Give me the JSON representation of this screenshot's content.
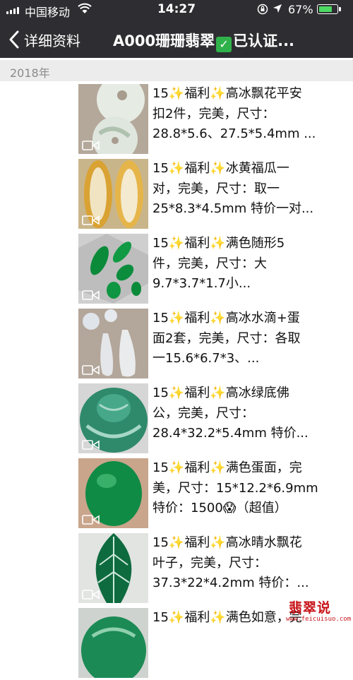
{
  "status_bar": {
    "carrier": "中国移动",
    "time": "14:27",
    "battery": "67%",
    "battery_level": 0.67
  },
  "nav": {
    "back_label": "详细资料",
    "title_prefix": "A000珊珊翡翠",
    "title_suffix": "已认证..."
  },
  "year": "2018年",
  "posts": [
    {
      "lines": [
        "15✨福利✨高冰飘花平安",
        "扣2件，完美，尺寸：",
        "28.8*5.6、27.5*5.4mm ..."
      ]
    },
    {
      "lines": [
        "15✨福利✨冰黄福瓜一",
        "对，完美，尺寸：取一",
        "25*8.3*4.5mm 特价一对..."
      ]
    },
    {
      "lines": [
        "15✨福利✨满色随形5",
        "件，完美，尺寸：大",
        "9.7*3.7*1.7小..."
      ]
    },
    {
      "lines": [
        "15✨福利✨高冰水滴+蛋",
        "面2套，完美，尺寸：各取",
        "一15.6*6.7*3、..."
      ]
    },
    {
      "lines": [
        "15✨福利✨高冰绿底佛",
        "公，完美，尺寸：",
        "28.4*32.2*5.4mm 特价..."
      ]
    },
    {
      "lines": [
        "15✨福利✨满色蛋面，完",
        "美，尺寸：15*12.2*6.9mm",
        "特价：1500😱（超值）"
      ]
    },
    {
      "lines": [
        "15✨福利✨高冰晴水飘花",
        "叶子，完美，尺寸：",
        "37.3*22*4.2mm 特价：..."
      ]
    },
    {
      "lines": [
        "15✨福利✨满色如意，完",
        "",
        ""
      ]
    }
  ],
  "watermark": {
    "title": "翡翠说",
    "url": "www.feicuisuo.com"
  },
  "colors": {
    "topbar": "#2e2e32",
    "year_bar": "#ececed",
    "battery_fill": "#4cd964",
    "check": "#30b24a",
    "watermark": "#c8151b"
  }
}
